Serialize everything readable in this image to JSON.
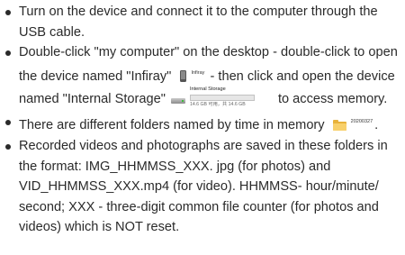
{
  "instructions": {
    "item1": "Turn on the device and connect it to the computer through the USB cable.",
    "item2": {
      "t1": "Double-click \"my computer\" on the desktop - double-click to open the device named \"Infiray\"",
      "device_icon_label": "Infiray",
      "t2": "- then click and open the device named \"Internal Storage\"",
      "storage": {
        "name": "Internal Storage",
        "size_text": "14.6 GB 可用，共 14.6 GB",
        "used_fraction": 0.01
      },
      "t3": "to access memory."
    },
    "item3": {
      "t1": "There are different folders named by time in memory",
      "folder_label": "20200327",
      "t2": "."
    },
    "item4": "Recorded videos and photographs are saved in these folders in the format: IMG_HHMMSS_XXX. jpg (for photos) and VID_HHMMSS_XXX.mp4 (for video). HHMMSS- hour/minute/ second; XXX - three-digit common file counter (for photos and videos) which is NOT reset."
  },
  "icons": {
    "bullet": "bullet-dot",
    "device": "phone-device-icon",
    "storage": "hard-drive-icon",
    "folder": "folder-icon"
  },
  "colors": {
    "text": "#2a2a2a",
    "storage_bar": "#26a0da",
    "folder": "#f8d06a"
  }
}
